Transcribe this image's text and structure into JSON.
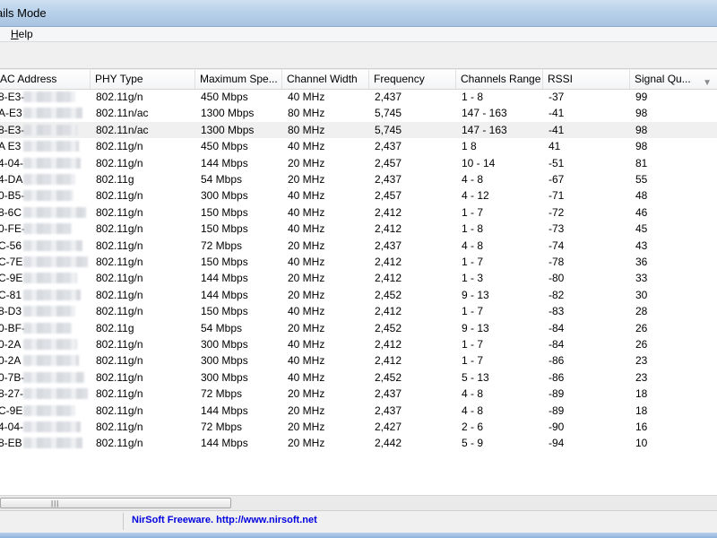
{
  "window": {
    "title": "ails Mode"
  },
  "menu": {
    "items": [
      {
        "label": "Help"
      }
    ]
  },
  "columns": [
    {
      "key": "mac",
      "label": "AC Address"
    },
    {
      "key": "phy",
      "label": "PHY Type"
    },
    {
      "key": "speed",
      "label": "Maximum Spe..."
    },
    {
      "key": "width",
      "label": "Channel Width"
    },
    {
      "key": "freq",
      "label": "Frequency"
    },
    {
      "key": "range",
      "label": "Channels Range"
    },
    {
      "key": "rssi",
      "label": "RSSI"
    },
    {
      "key": "signal",
      "label": "Signal Qu..."
    }
  ],
  "rows": [
    {
      "mac": "8-E3-",
      "phy": "802.11g/n",
      "speed": "450 Mbps",
      "width": "40 MHz",
      "freq": "2,437",
      "range": "1 - 8",
      "rssi": "-37",
      "signal": "99"
    },
    {
      "mac": "A-E3",
      "phy": "802.11n/ac",
      "speed": "1300 Mbps",
      "width": "80 MHz",
      "freq": "5,745",
      "range": "147 - 163",
      "rssi": "-41",
      "signal": "98"
    },
    {
      "mac": "8-E3-",
      "phy": "802.11n/ac",
      "speed": "1300 Mbps",
      "width": "80 MHz",
      "freq": "5,745",
      "range": "147 - 163",
      "rssi": "-41",
      "signal": "98",
      "selected": true
    },
    {
      "mac": "A E3",
      "phy": "802.11g/n",
      "speed": "450 Mbps",
      "width": "40 MHz",
      "freq": "2,437",
      "range": "1 8",
      "rssi": "41",
      "signal": "98"
    },
    {
      "mac": "4-04-",
      "phy": "802.11g/n",
      "speed": "144 Mbps",
      "width": "20 MHz",
      "freq": "2,457",
      "range": "10 - 14",
      "rssi": "-51",
      "signal": "81"
    },
    {
      "mac": "4-DA",
      "phy": "802.11g",
      "speed": "54 Mbps",
      "width": "20 MHz",
      "freq": "2,437",
      "range": "4 - 8",
      "rssi": "-67",
      "signal": "55"
    },
    {
      "mac": "0-B5-",
      "phy": "802.11g/n",
      "speed": "300 Mbps",
      "width": "40 MHz",
      "freq": "2,457",
      "range": "4 - 12",
      "rssi": "-71",
      "signal": "48"
    },
    {
      "mac": "8-6C",
      "phy": "802.11g/n",
      "speed": "150 Mbps",
      "width": "40 MHz",
      "freq": "2,412",
      "range": "1 - 7",
      "rssi": "-72",
      "signal": "46"
    },
    {
      "mac": "0-FE-",
      "phy": "802.11g/n",
      "speed": "150 Mbps",
      "width": "40 MHz",
      "freq": "2,412",
      "range": "1 - 8",
      "rssi": "-73",
      "signal": "45"
    },
    {
      "mac": "C-56",
      "phy": "802.11g/n",
      "speed": "72 Mbps",
      "width": "20 MHz",
      "freq": "2,437",
      "range": "4 - 8",
      "rssi": "-74",
      "signal": "43"
    },
    {
      "mac": "C-7E",
      "phy": "802.11g/n",
      "speed": "150 Mbps",
      "width": "40 MHz",
      "freq": "2,412",
      "range": "1 - 7",
      "rssi": "-78",
      "signal": "36"
    },
    {
      "mac": "C-9E",
      "phy": "802.11g/n",
      "speed": "144 Mbps",
      "width": "20 MHz",
      "freq": "2,412",
      "range": "1 - 3",
      "rssi": "-80",
      "signal": "33"
    },
    {
      "mac": "C-81",
      "phy": "802.11g/n",
      "speed": "144 Mbps",
      "width": "20 MHz",
      "freq": "2,452",
      "range": "9 - 13",
      "rssi": "-82",
      "signal": "30"
    },
    {
      "mac": "8-D3",
      "phy": "802.11g/n",
      "speed": "150 Mbps",
      "width": "40 MHz",
      "freq": "2,412",
      "range": "1 - 7",
      "rssi": "-83",
      "signal": "28"
    },
    {
      "mac": "0-BF-",
      "phy": "802.11g",
      "speed": "54 Mbps",
      "width": "20 MHz",
      "freq": "2,452",
      "range": "9 - 13",
      "rssi": "-84",
      "signal": "26"
    },
    {
      "mac": "0-2A",
      "phy": "802.11g/n",
      "speed": "300 Mbps",
      "width": "40 MHz",
      "freq": "2,412",
      "range": "1 - 7",
      "rssi": "-84",
      "signal": "26"
    },
    {
      "mac": "0-2A",
      "phy": "802.11g/n",
      "speed": "300 Mbps",
      "width": "40 MHz",
      "freq": "2,412",
      "range": "1 - 7",
      "rssi": "-86",
      "signal": "23"
    },
    {
      "mac": "0-7B-",
      "phy": "802.11g/n",
      "speed": "300 Mbps",
      "width": "40 MHz",
      "freq": "2,452",
      "range": "5 - 13",
      "rssi": "-86",
      "signal": "23"
    },
    {
      "mac": "8-27-",
      "phy": "802.11g/n",
      "speed": "72 Mbps",
      "width": "20 MHz",
      "freq": "2,437",
      "range": "4 - 8",
      "rssi": "-89",
      "signal": "18"
    },
    {
      "mac": "C-9E",
      "phy": "802.11g/n",
      "speed": "144 Mbps",
      "width": "20 MHz",
      "freq": "2,437",
      "range": "4 - 8",
      "rssi": "-89",
      "signal": "18"
    },
    {
      "mac": "4-04-",
      "phy": "802.11g/n",
      "speed": "72 Mbps",
      "width": "20 MHz",
      "freq": "2,427",
      "range": "2 - 6",
      "rssi": "-90",
      "signal": "16"
    },
    {
      "mac": "8-EB",
      "phy": "802.11g/n",
      "speed": "144 Mbps",
      "width": "20 MHz",
      "freq": "2,442",
      "range": "5 - 9",
      "rssi": "-94",
      "signal": "10"
    }
  ],
  "status": {
    "link_text": "NirSoft Freeware.  http://www.nirsoft.net"
  },
  "icons": {
    "sort": "sort-descending-icon"
  }
}
